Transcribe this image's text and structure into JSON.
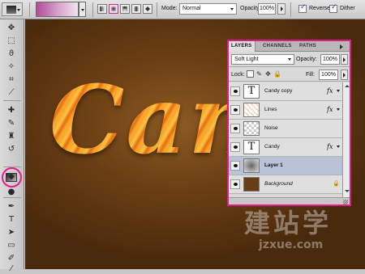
{
  "options_bar": {
    "mode_label": "Mode:",
    "mode_value": "Normal",
    "opacity_label": "Opacity:",
    "opacity_value": "100%",
    "reverse_label": "Reverse",
    "dither_label": "Dither",
    "gradient_colors": [
      "#b34b9a",
      "#d8a6cd",
      "#f1e3ef"
    ]
  },
  "toolbar": {
    "tools": [
      {
        "name": "move-tool",
        "glyph": "✥"
      },
      {
        "name": "marquee-tool",
        "glyph": "⬚"
      },
      {
        "name": "lasso-tool",
        "glyph": "ϑ"
      },
      {
        "name": "magic-wand-tool",
        "glyph": "✧"
      },
      {
        "name": "crop-tool",
        "glyph": "⌗"
      },
      {
        "name": "slice-tool",
        "glyph": "⟋"
      },
      {
        "name": "healing-brush-tool",
        "glyph": "✚"
      },
      {
        "name": "brush-tool",
        "glyph": "✎"
      },
      {
        "name": "clone-stamp-tool",
        "glyph": "♜"
      },
      {
        "name": "history-brush-tool",
        "glyph": "↺"
      },
      {
        "name": "eraser-tool",
        "glyph": "▱"
      },
      {
        "name": "blur-tool",
        "glyph": "◆"
      },
      {
        "name": "dodge-tool",
        "glyph": "●"
      },
      {
        "name": "pen-tool",
        "glyph": "✒"
      },
      {
        "name": "type-tool",
        "glyph": "T"
      },
      {
        "name": "path-selection-tool",
        "glyph": "➤"
      },
      {
        "name": "shape-tool",
        "glyph": "▭"
      },
      {
        "name": "notes-tool",
        "glyph": "✐"
      },
      {
        "name": "eyedropper-tool",
        "glyph": "⁄"
      }
    ]
  },
  "canvas": {
    "text": "Can",
    "watermark_cn": "建站学",
    "watermark_en": "jzxue.com"
  },
  "layers_panel": {
    "tabs": [
      "LAYERS",
      "CHANNELS",
      "PATHS"
    ],
    "blend_mode": "Soft Light",
    "opacity_label": "Opacity:",
    "opacity_value": "100%",
    "lock_label": "Lock:",
    "fill_label": "Fill:",
    "fill_value": "100%",
    "layers": [
      {
        "name": "Candy copy",
        "thumb": "T",
        "fx": "fx",
        "selected": false
      },
      {
        "name": "Lines",
        "thumb": "lines",
        "fx": "fx",
        "selected": false
      },
      {
        "name": "Noise",
        "thumb": "checker",
        "fx": "",
        "selected": false
      },
      {
        "name": "Candy",
        "thumb": "T",
        "fx": "fx",
        "selected": false
      },
      {
        "name": "Layer 1",
        "thumb": "layer1",
        "fx": "",
        "selected": true
      },
      {
        "name": "Background",
        "thumb": "brown",
        "fx": "",
        "selected": false,
        "locked": true
      }
    ]
  }
}
